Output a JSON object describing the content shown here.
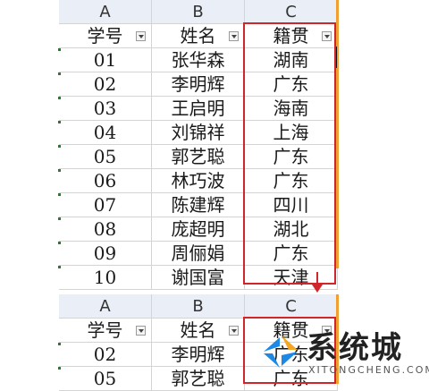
{
  "table1": {
    "columns": [
      "A",
      "B",
      "C"
    ],
    "headers": [
      "学号",
      "姓名",
      "籍贯"
    ],
    "rows": [
      [
        "01",
        "张华森",
        "湖南"
      ],
      [
        "02",
        "李明辉",
        "广东"
      ],
      [
        "03",
        "王启明",
        "海南"
      ],
      [
        "04",
        "刘锦祥",
        "上海"
      ],
      [
        "05",
        "郭艺聪",
        "广东"
      ],
      [
        "06",
        "林巧波",
        "广东"
      ],
      [
        "07",
        "陈建辉",
        "四川"
      ],
      [
        "08",
        "庞超明",
        "湖北"
      ],
      [
        "09",
        "周俪娟",
        "广东"
      ],
      [
        "10",
        "谢国富",
        "天津"
      ]
    ]
  },
  "table2": {
    "columns": [
      "A",
      "B",
      "C"
    ],
    "headers": [
      "学号",
      "姓名",
      "籍贯"
    ],
    "rows": [
      [
        "02",
        "李明辉",
        "广东"
      ],
      [
        "05",
        "郭艺聪",
        "广东"
      ]
    ]
  },
  "watermark": {
    "title": "系统城",
    "subtitle": "XITONGCHENG.COM",
    "colors": {
      "primary": "#1e88e5",
      "accent": "#f5a623"
    }
  },
  "colors": {
    "highlight": "#d0262b",
    "header_bg": "#e9eef7",
    "gridline": "#d4d4d4"
  }
}
